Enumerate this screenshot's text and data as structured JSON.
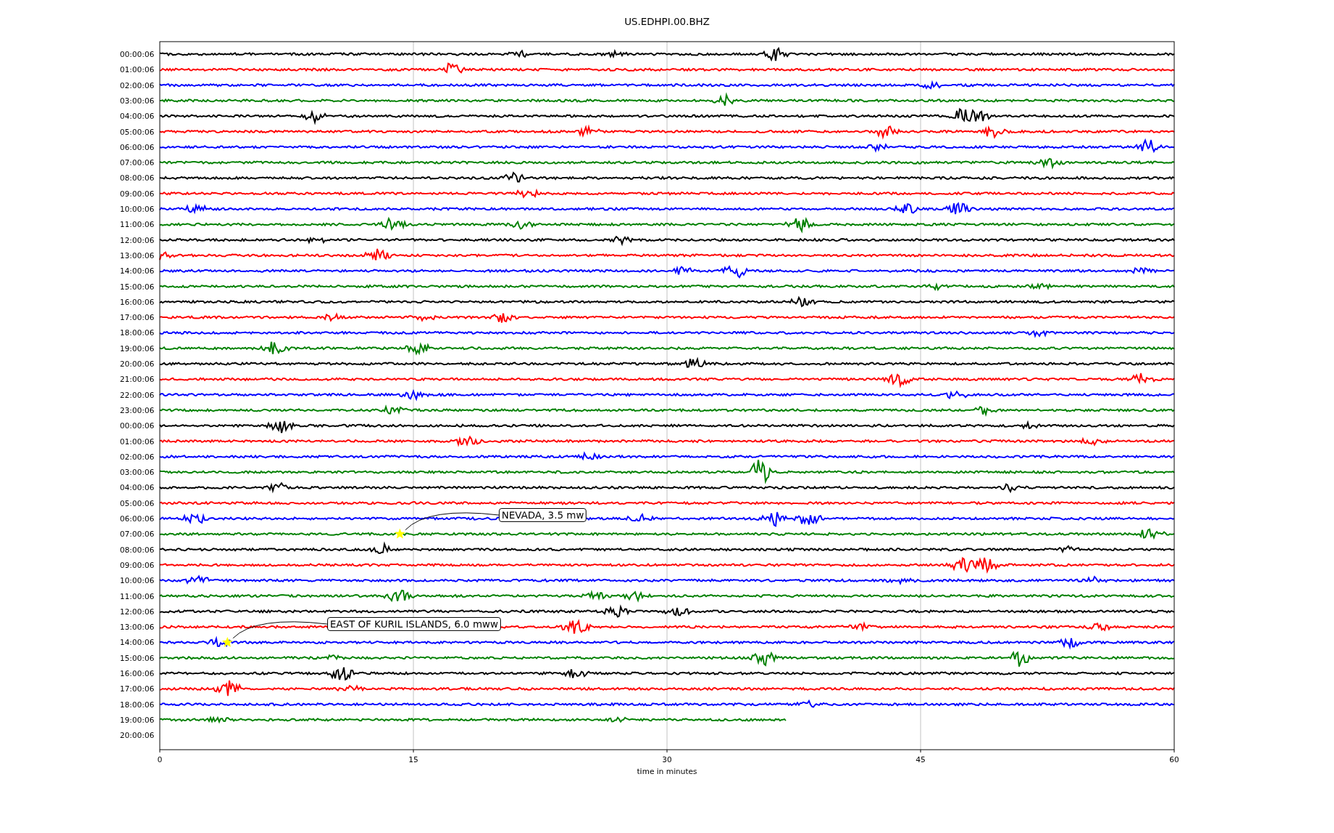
{
  "title": "US.EDHPI.00.BHZ",
  "rows": [
    {
      "label": "00:00:06",
      "color": "#000000",
      "level": 1
    },
    {
      "label": "01:00:06",
      "color": "#ff0000",
      "level": 1
    },
    {
      "label": "02:00:06",
      "color": "#0000ff",
      "level": 1
    },
    {
      "label": "03:00:06",
      "color": "#008000",
      "level": 1
    },
    {
      "label": "04:00:06",
      "color": "#000000",
      "level": 1
    },
    {
      "label": "05:00:06",
      "color": "#ff0000",
      "level": 1
    },
    {
      "label": "06:00:06",
      "color": "#0000ff",
      "level": 1
    },
    {
      "label": "07:00:06",
      "color": "#008000",
      "level": 1
    },
    {
      "label": "08:00:06",
      "color": "#000000",
      "level": 1
    },
    {
      "label": "09:00:06",
      "color": "#ff0000",
      "level": 1
    },
    {
      "label": "10:00:06",
      "color": "#0000ff",
      "level": 1
    },
    {
      "label": "11:00:06",
      "color": "#008000",
      "level": 1
    },
    {
      "label": "12:00:06",
      "color": "#000000",
      "level": 1
    },
    {
      "label": "13:00:06",
      "color": "#ff0000",
      "level": 1
    },
    {
      "label": "14:00:06",
      "color": "#0000ff",
      "level": 1
    },
    {
      "label": "15:00:06",
      "color": "#008000",
      "level": 1
    },
    {
      "label": "16:00:06",
      "color": "#000000",
      "level": 1
    },
    {
      "label": "17:00:06",
      "color": "#ff0000",
      "level": 1
    },
    {
      "label": "18:00:06",
      "color": "#0000ff",
      "level": 1
    },
    {
      "label": "19:00:06",
      "color": "#008000",
      "level": 1
    },
    {
      "label": "20:00:06",
      "color": "#000000",
      "level": 1
    },
    {
      "label": "21:00:06",
      "color": "#ff0000",
      "level": 1
    },
    {
      "label": "22:00:06",
      "color": "#0000ff",
      "level": 1
    },
    {
      "label": "23:00:06",
      "color": "#008000",
      "level": 1
    },
    {
      "label": "00:00:06",
      "color": "#000000",
      "level": 1
    },
    {
      "label": "01:00:06",
      "color": "#ff0000",
      "level": 1
    },
    {
      "label": "02:00:06",
      "color": "#0000ff",
      "level": 1
    },
    {
      "label": "03:00:06",
      "color": "#008000",
      "level": 1
    },
    {
      "label": "04:00:06",
      "color": "#000000",
      "level": 1
    },
    {
      "label": "05:00:06",
      "color": "#ff0000",
      "level": 1
    },
    {
      "label": "06:00:06",
      "color": "#0000ff",
      "level": 1
    },
    {
      "label": "07:00:06",
      "color": "#008000",
      "level": 1,
      "event": "NEVADA, 3.5 mw"
    },
    {
      "label": "08:00:06",
      "color": "#000000",
      "level": 1
    },
    {
      "label": "09:00:06",
      "color": "#ff0000",
      "level": 1
    },
    {
      "label": "10:00:06",
      "color": "#0000ff",
      "level": 1
    },
    {
      "label": "11:00:06",
      "color": "#008000",
      "level": 1
    },
    {
      "label": "12:00:06",
      "color": "#000000",
      "level": 1
    },
    {
      "label": "13:00:06",
      "color": "#ff0000",
      "level": 1
    },
    {
      "label": "14:00:06",
      "color": "#0000ff",
      "level": 1,
      "event": "EAST OF KURIL ISLANDS, 6.0 mww"
    },
    {
      "label": "15:00:06",
      "color": "#008000",
      "level": 1
    },
    {
      "label": "16:00:06",
      "color": "#000000",
      "level": 1
    },
    {
      "label": "17:00:06",
      "color": "#ff0000",
      "level": 1
    },
    {
      "label": "18:00:06",
      "color": "#0000ff",
      "level": 1
    },
    {
      "label": "19:00:06",
      "color": "#008000",
      "level": 0.617
    },
    {
      "label": "20:00:06"
    }
  ],
  "x_ticks": [
    "0",
    "15",
    "30",
    "45",
    "60"
  ],
  "x_label": "time in minutes"
}
